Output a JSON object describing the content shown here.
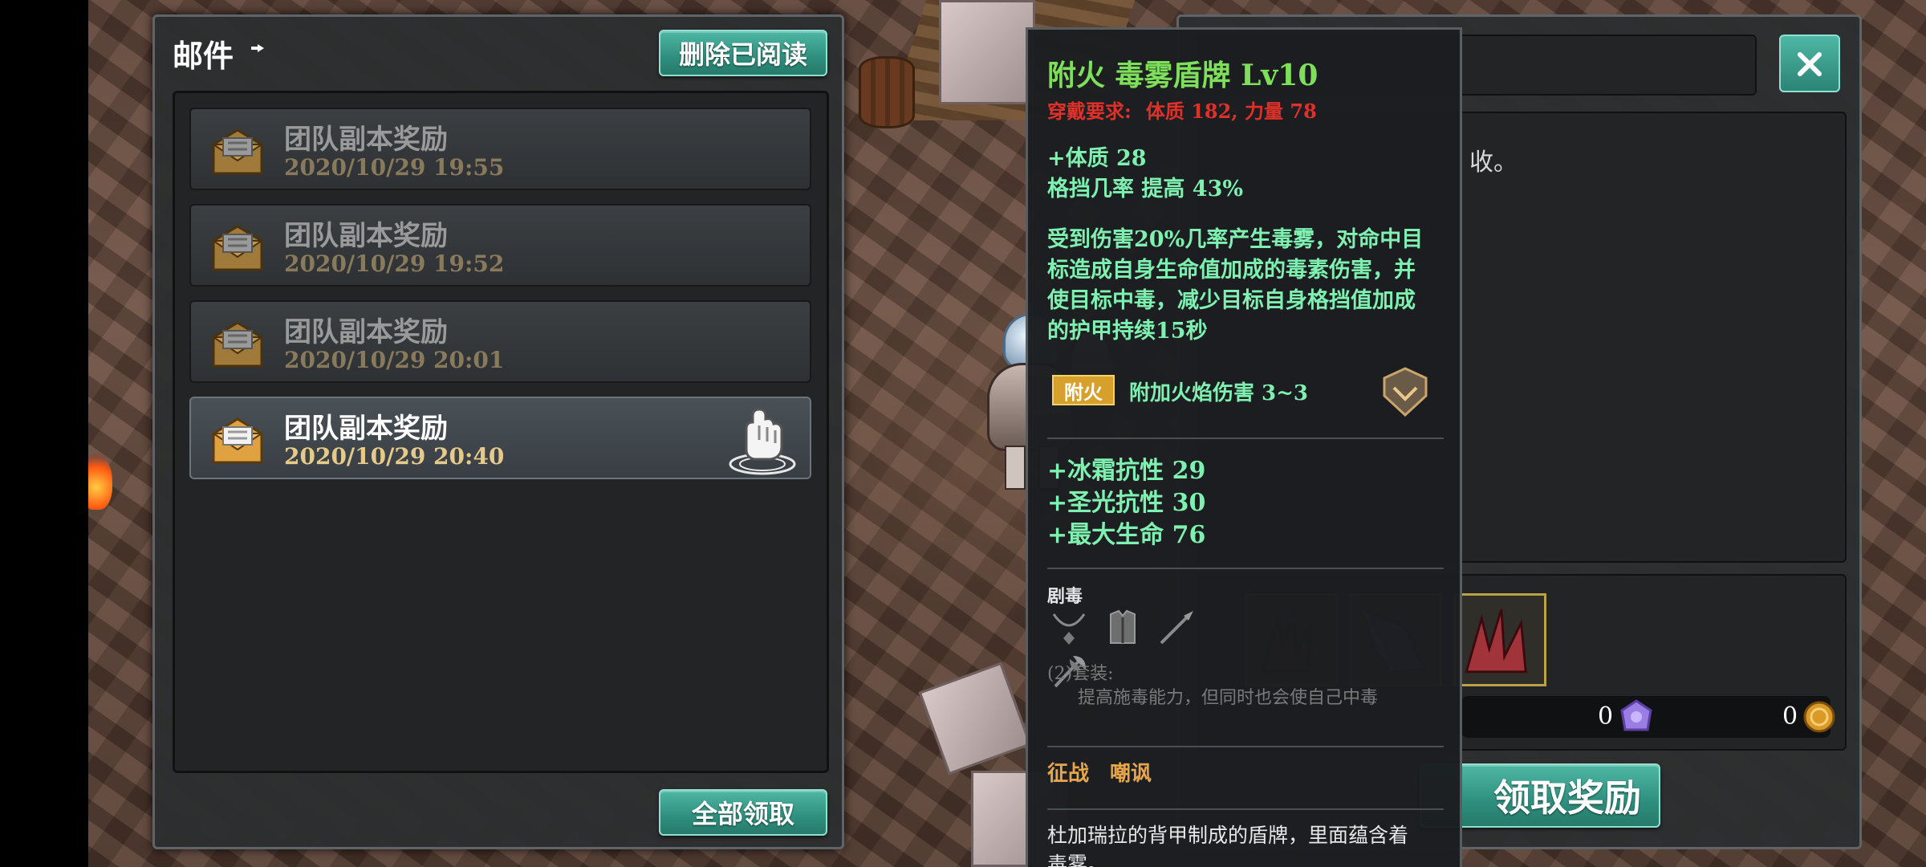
{
  "mail_panel": {
    "title": "邮件",
    "delete_read_label": "删除已阅读",
    "claim_all_label": "全部领取",
    "mails": [
      {
        "subject": "团队副本奖励",
        "date": "2020/10/29  19:55",
        "read": true
      },
      {
        "subject": "团队副本奖励",
        "date": "2020/10/29  19:52",
        "read": true
      },
      {
        "subject": "团队副本奖励",
        "date": "2020/10/29  20:01",
        "read": true
      },
      {
        "subject": "团队副本奖励",
        "date": "2020/10/29  20:40",
        "read": false,
        "selected": true
      }
    ]
  },
  "detail_panel": {
    "body_text_fragment": "收。",
    "claim_label_fragment": "领取奖励",
    "gem_count": "0",
    "coin_count": "0",
    "attachments": [
      "red-shard-item",
      "purple-crystal-item",
      "red-shard-item"
    ]
  },
  "tooltip": {
    "name": "附火  毒雾盾牌  Lv10",
    "req_label": "穿戴要求:",
    "req_value": "体质 182, 力量 78",
    "stats": [
      "+体质 28",
      "格挡几率 提高 43%"
    ],
    "effect_lines": [
      "受到伤害20%几率产生毒雾，对命中目",
      "标造成自身生命值加成的毒素伤害，并",
      "使目标中毒，减少目标自身格挡值加成",
      "的护甲持续15秒"
    ],
    "enchant_tag": "附火",
    "enchant_effect": "附加火焰伤害 3~3",
    "resists": [
      "+冰霜抗性  29",
      "+圣光抗性  30",
      "+最大生命  76"
    ],
    "set_name": "剧毒",
    "set_bonus_label": "(2)套装:",
    "set_bonus_desc": "提高施毒能力，但同时也会使自己中毒",
    "tags": [
      "征战",
      "嘲讽"
    ],
    "flavor_lines": [
      "杜加瑞拉的背甲制成的盾牌，里面蕴含着",
      "毒雾。"
    ]
  },
  "colors": {
    "accent_teal": "#3aa392",
    "item_name_green": "#7ee05a",
    "stat_green": "#7ef0b0",
    "requirement_red": "#e0302a",
    "tag_orange": "#e7a64a",
    "date_gold": "#e7c98a"
  }
}
